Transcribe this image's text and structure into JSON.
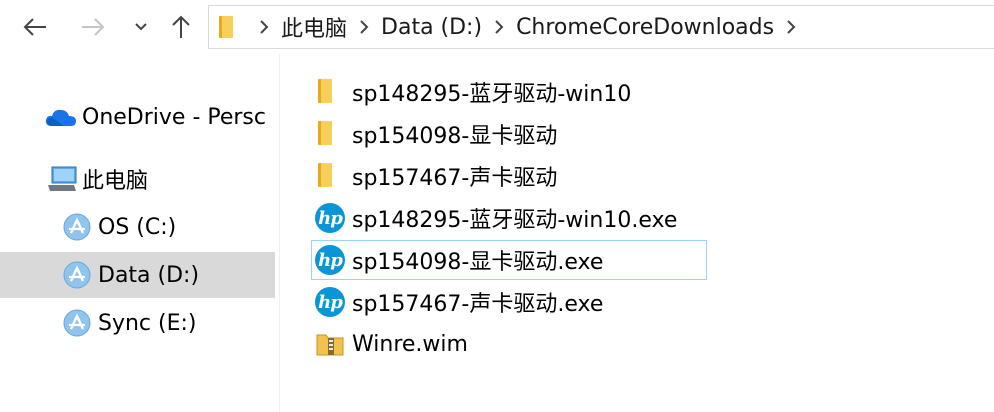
{
  "toolbar": {
    "back_icon": "arrow-left-icon",
    "forward_icon": "arrow-right-icon",
    "recent_icon": "chevron-down-icon",
    "up_icon": "arrow-up-icon"
  },
  "address": {
    "crumbs": [
      "此电脑",
      "Data (D:)",
      "ChromeCoreDownloads"
    ]
  },
  "nav": {
    "items": [
      {
        "label": "OneDrive - Persc",
        "icon": "cloud-icon"
      },
      {
        "label": "此电脑",
        "icon": "computer-icon"
      },
      {
        "label": "OS (C:)",
        "icon": "drive-icon"
      },
      {
        "label": "Data (D:)",
        "icon": "drive-icon",
        "selected": true
      },
      {
        "label": "Sync (E:)",
        "icon": "drive-icon"
      }
    ]
  },
  "files": [
    {
      "name": "sp148295-蓝牙驱动-win10",
      "type": "folder"
    },
    {
      "name": "sp154098-显卡驱动",
      "type": "folder"
    },
    {
      "name": "sp157467-声卡驱动",
      "type": "folder"
    },
    {
      "name": "sp148295-蓝牙驱动-win10.exe",
      "type": "hp-exe"
    },
    {
      "name": "sp154098-显卡驱动.exe",
      "type": "hp-exe",
      "focused": true
    },
    {
      "name": "sp157467-声卡驱动.exe",
      "type": "hp-exe"
    },
    {
      "name": "Winre.wim",
      "type": "archive"
    }
  ],
  "hp_logo_text": "hp",
  "colors": {
    "selected_bg": "#d9d9d9",
    "focus_border": "#99d1ff",
    "folder_yellow": "#f7cf5a",
    "hp_blue": "#0a96d6",
    "onedrive_blue": "#1a73e8"
  }
}
